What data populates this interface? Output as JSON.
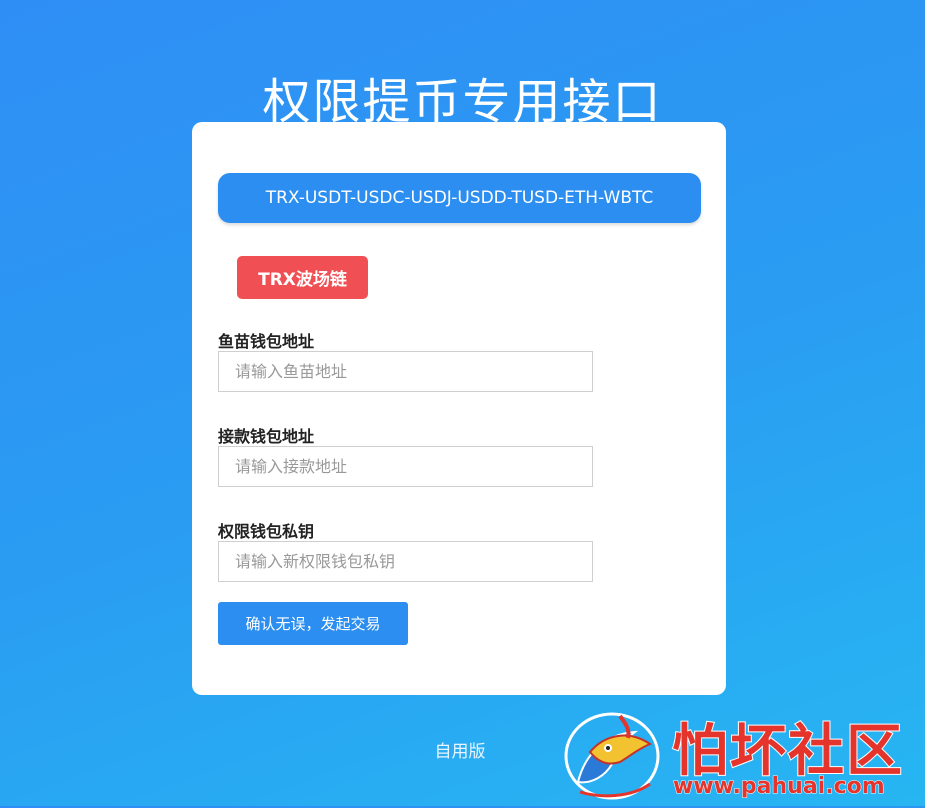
{
  "header": {
    "title": "权限提币专用接口"
  },
  "card": {
    "tokens_banner": "TRX-USDT-USDC-USDJ-USDD-TUSD-ETH-WBTC",
    "chain_badge": "TRX波场链",
    "fields": [
      {
        "label": "鱼苗钱包地址",
        "placeholder": "请输入鱼苗地址",
        "value": ""
      },
      {
        "label": "接款钱包地址",
        "placeholder": "请输入接款地址",
        "value": ""
      },
      {
        "label": "权限钱包私钥",
        "placeholder": "请输入新权限钱包私钥",
        "value": ""
      }
    ],
    "submit_label": "确认无误，发起交易"
  },
  "footer": {
    "text": "自用版"
  },
  "watermark": {
    "name": "怕坏社区",
    "url": "www.pahuai.com",
    "logo_icon": "fish-logo-icon"
  },
  "colors": {
    "background_top": "#2f8ef5",
    "background_bottom": "#27b6f2",
    "primary": "#2b8ef0",
    "badge": "#f05054",
    "watermark": "#e5342c"
  }
}
